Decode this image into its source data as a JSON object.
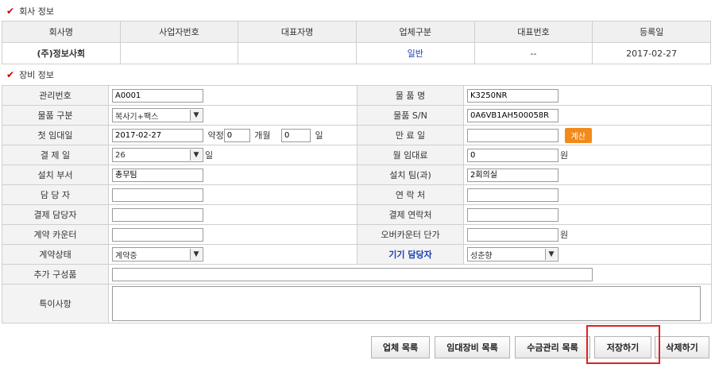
{
  "company_section": {
    "title": "회사 정보",
    "headers": [
      "회사명",
      "사업자번호",
      "대표자명",
      "업체구분",
      "대표번호",
      "등록일"
    ],
    "row": [
      "(주)정보사회",
      "",
      "",
      "일반",
      "--",
      "2017-02-27"
    ]
  },
  "equip_section": {
    "title": "장비 정보",
    "mgmt_no_label": "관리번호",
    "mgmt_no": "A0001",
    "product_name_label": "물 품 명",
    "product_name": "K3250NR",
    "category_label": "물품 구분",
    "category": "복사기+팩스",
    "serial_label": "물품 S/N",
    "serial": "0A6VB1AH500058R",
    "first_rent_label": "첫 임대일",
    "first_rent": "2017-02-27",
    "contract_label": "약정",
    "contract_months": "0",
    "months_unit": "개월",
    "contract_days": "0",
    "days_unit": "일",
    "expire_label": "만 료 일",
    "expire": "",
    "calc_button": "계산",
    "payday_label": "결 제 일",
    "payday": "26",
    "payday_unit": "일",
    "monthly_fee_label": "월 임대료",
    "monthly_fee": "0",
    "won_unit": "원",
    "install_dept_label": "설치 부서",
    "install_dept": "총무팀",
    "install_team_label": "설치 팀(과)",
    "install_team": "2회의실",
    "manager_label": "담 당 자",
    "manager": "",
    "contact_label": "연 락 처",
    "contact": "",
    "pay_manager_label": "결제 담당자",
    "pay_manager": "",
    "pay_contact_label": "결제 연락처",
    "pay_contact": "",
    "counter_label": "계약 카운터",
    "counter": "",
    "over_counter_label": "오버카운터 단가",
    "over_counter": "",
    "over_won_unit": "원",
    "status_label": "계약상태",
    "status": "계약중",
    "device_manager_label": "기기 담당자",
    "device_manager": "성춘향",
    "extra_label": "추가 구성품",
    "extra": "",
    "notes_label": "특이사항",
    "notes": ""
  },
  "buttons": {
    "company_list": "업체 목록",
    "rental_list": "임대장비 목록",
    "collection_list": "수금관리 목록",
    "save": "저장하기",
    "delete": "삭제하기"
  },
  "colors": {
    "accent_orange": "#f28a1b",
    "highlight_red": "#e02020",
    "link_blue": "#1a3fb5"
  }
}
